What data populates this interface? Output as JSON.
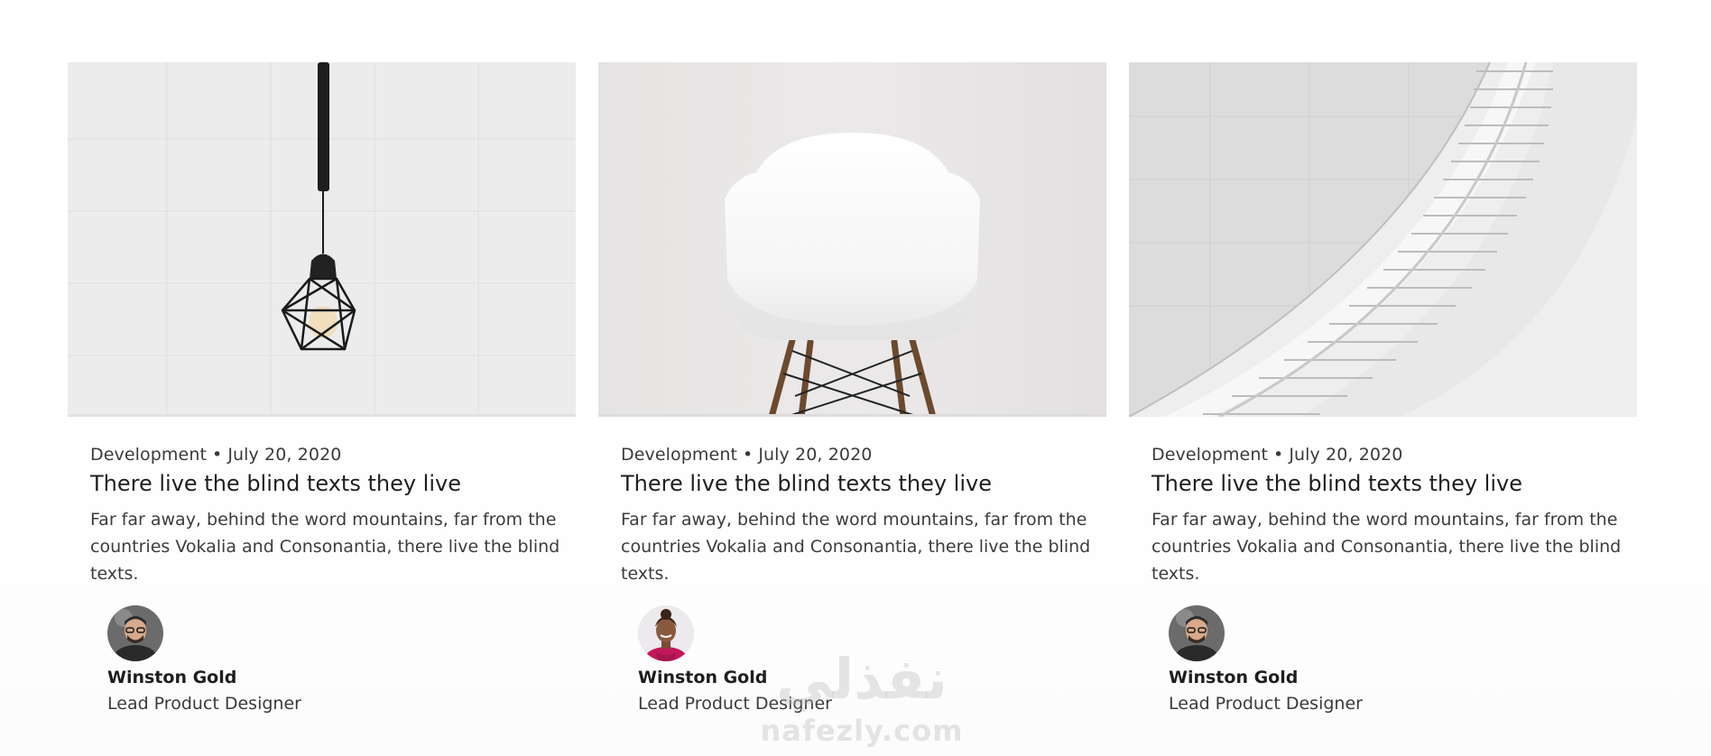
{
  "cards": [
    {
      "image_icon": "pendant-lamp-image",
      "category": "Development",
      "date": "July 20, 2020",
      "title": "There live the blind texts they live",
      "excerpt": "Far far away, behind the word mountains, far from the countries Vokalia and Consonantia, there live the blind texts.",
      "author": {
        "name": "Winston Gold",
        "role": "Lead Product Designer"
      }
    },
    {
      "image_icon": "white-chair-image",
      "category": "Development",
      "date": "July 20, 2020",
      "title": "There live the blind texts they live",
      "excerpt": "Far far away, behind the word mountains, far from the countries Vokalia and Consonantia, there live the blind texts.",
      "author": {
        "name": "Winston Gold",
        "role": "Lead Product Designer"
      }
    },
    {
      "image_icon": "spiral-staircase-image",
      "category": "Development",
      "date": "July 20, 2020",
      "title": "There live the blind texts they live",
      "excerpt": "Far far away, behind the word mountains, far from the countries Vokalia and Consonantia, there live the blind texts.",
      "author": {
        "name": "Winston Gold",
        "role": "Lead Product Designer"
      }
    }
  ],
  "meta_separator": "•",
  "watermark": {
    "arabic": "نفذلي",
    "latin": "nafezly.com"
  }
}
